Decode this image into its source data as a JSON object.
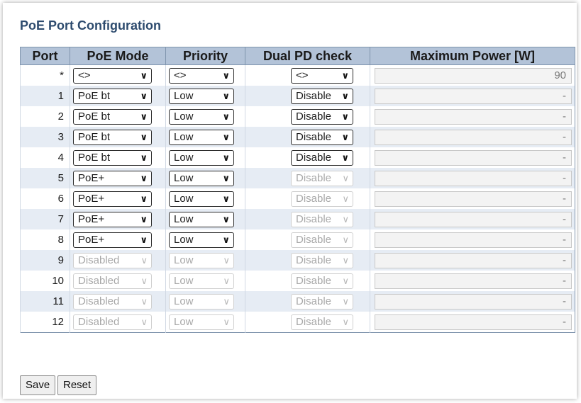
{
  "page": {
    "title": "PoE Port Configuration"
  },
  "table": {
    "headers": [
      "Port",
      "PoE Mode",
      "Priority",
      "Dual PD check",
      "Maximum Power [W]"
    ],
    "rows": [
      {
        "port": "*",
        "mode": "<>",
        "mode_enabled": true,
        "priority": "<>",
        "priority_enabled": true,
        "dual": "<>",
        "dual_enabled": true,
        "power": "90"
      },
      {
        "port": "1",
        "mode": "PoE bt",
        "mode_enabled": true,
        "priority": "Low",
        "priority_enabled": true,
        "dual": "Disable",
        "dual_enabled": true,
        "power": "-"
      },
      {
        "port": "2",
        "mode": "PoE bt",
        "mode_enabled": true,
        "priority": "Low",
        "priority_enabled": true,
        "dual": "Disable",
        "dual_enabled": true,
        "power": "-"
      },
      {
        "port": "3",
        "mode": "PoE bt",
        "mode_enabled": true,
        "priority": "Low",
        "priority_enabled": true,
        "dual": "Disable",
        "dual_enabled": true,
        "power": "-"
      },
      {
        "port": "4",
        "mode": "PoE bt",
        "mode_enabled": true,
        "priority": "Low",
        "priority_enabled": true,
        "dual": "Disable",
        "dual_enabled": true,
        "power": "-"
      },
      {
        "port": "5",
        "mode": "PoE+",
        "mode_enabled": true,
        "priority": "Low",
        "priority_enabled": true,
        "dual": "Disable",
        "dual_enabled": false,
        "power": "-"
      },
      {
        "port": "6",
        "mode": "PoE+",
        "mode_enabled": true,
        "priority": "Low",
        "priority_enabled": true,
        "dual": "Disable",
        "dual_enabled": false,
        "power": "-"
      },
      {
        "port": "7",
        "mode": "PoE+",
        "mode_enabled": true,
        "priority": "Low",
        "priority_enabled": true,
        "dual": "Disable",
        "dual_enabled": false,
        "power": "-"
      },
      {
        "port": "8",
        "mode": "PoE+",
        "mode_enabled": true,
        "priority": "Low",
        "priority_enabled": true,
        "dual": "Disable",
        "dual_enabled": false,
        "power": "-"
      },
      {
        "port": "9",
        "mode": "Disabled",
        "mode_enabled": false,
        "priority": "Low",
        "priority_enabled": false,
        "dual": "Disable",
        "dual_enabled": false,
        "power": "-"
      },
      {
        "port": "10",
        "mode": "Disabled",
        "mode_enabled": false,
        "priority": "Low",
        "priority_enabled": false,
        "dual": "Disable",
        "dual_enabled": false,
        "power": "-"
      },
      {
        "port": "11",
        "mode": "Disabled",
        "mode_enabled": false,
        "priority": "Low",
        "priority_enabled": false,
        "dual": "Disable",
        "dual_enabled": false,
        "power": "-"
      },
      {
        "port": "12",
        "mode": "Disabled",
        "mode_enabled": false,
        "priority": "Low",
        "priority_enabled": false,
        "dual": "Disable",
        "dual_enabled": false,
        "power": "-"
      }
    ]
  },
  "buttons": {
    "save": "Save",
    "reset": "Reset"
  },
  "icons": {
    "dropdown": "chevron-down-icon"
  },
  "colors": {
    "title": "#2d4b6e",
    "header_bg": "#b3c3d8",
    "row_alt_bg": "#e6ecf4"
  }
}
